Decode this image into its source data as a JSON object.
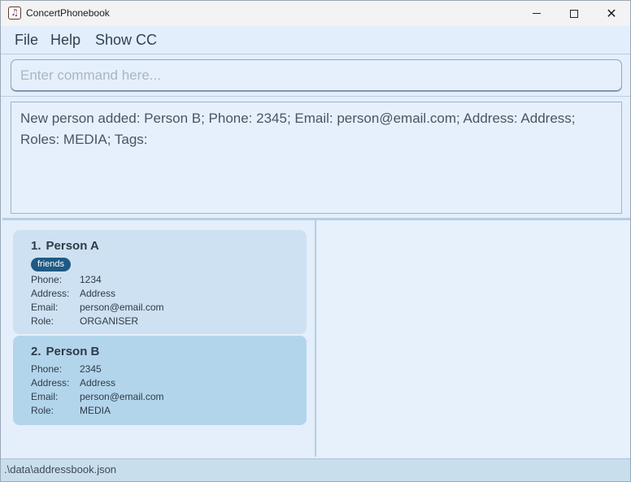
{
  "window": {
    "title": "ConcertPhonebook",
    "app_icon_glyph": "♫"
  },
  "menu": {
    "file": "File",
    "help": "Help",
    "show_cc": "Show CC"
  },
  "command": {
    "placeholder": "Enter command here...",
    "value": ""
  },
  "result": {
    "text": "New person added: Person B; Phone: 2345; Email: person@email.com; Address: Address; Roles: MEDIA; Tags:"
  },
  "persons": [
    {
      "index": "1.",
      "name": "Person A",
      "tags": [
        "friends"
      ],
      "phone_label": "Phone:",
      "phone": "1234",
      "address_label": "Address:",
      "address": "Address",
      "email_label": "Email:",
      "email": "person@email.com",
      "role_label": "Role:",
      "role": "ORGANISER"
    },
    {
      "index": "2.",
      "name": "Person B",
      "tags": [],
      "phone_label": "Phone:",
      "phone": "2345",
      "address_label": "Address:",
      "address": "Address",
      "email_label": "Email:",
      "email": "person@email.com",
      "role_label": "Role:",
      "role": "MEDIA"
    }
  ],
  "status": {
    "path": ".\\data\\addressbook.json"
  },
  "colors": {
    "tag_bg": "#1f5a84",
    "card_default": "#cde1f2",
    "card_selected": "#b3d5ec"
  },
  "icons": {
    "minimize": "minimize-icon",
    "maximize": "maximize-icon",
    "close": "close-icon"
  }
}
